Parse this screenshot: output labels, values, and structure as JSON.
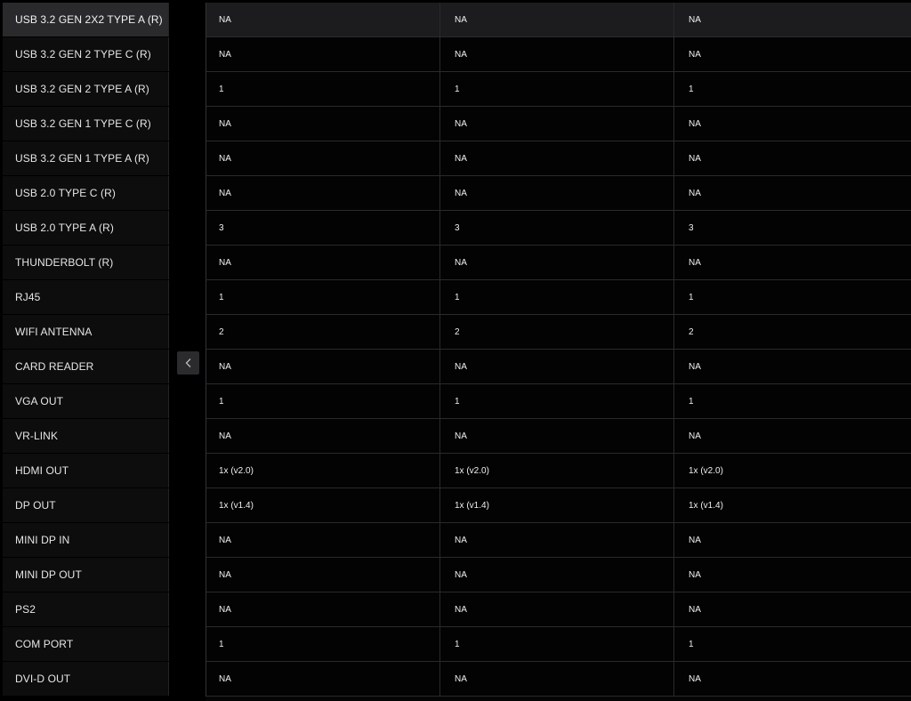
{
  "rows": [
    {
      "label": "USB 3.2 GEN 2X2 TYPE A (R)",
      "values": [
        "NA",
        "NA",
        "NA"
      ]
    },
    {
      "label": "USB 3.2 GEN 2 TYPE C (R)",
      "values": [
        "NA",
        "NA",
        "NA"
      ]
    },
    {
      "label": "USB 3.2 GEN 2 TYPE A (R)",
      "values": [
        "1",
        "1",
        "1"
      ]
    },
    {
      "label": "USB 3.2 GEN 1 TYPE C (R)",
      "values": [
        "NA",
        "NA",
        "NA"
      ]
    },
    {
      "label": "USB 3.2 GEN 1 TYPE A (R)",
      "values": [
        "NA",
        "NA",
        "NA"
      ]
    },
    {
      "label": "USB 2.0 TYPE C (R)",
      "values": [
        "NA",
        "NA",
        "NA"
      ]
    },
    {
      "label": "USB 2.0 TYPE A (R)",
      "values": [
        "3",
        "3",
        "3"
      ]
    },
    {
      "label": "THUNDERBOLT (R)",
      "values": [
        "NA",
        "NA",
        "NA"
      ]
    },
    {
      "label": "RJ45",
      "values": [
        "1",
        "1",
        "1"
      ]
    },
    {
      "label": "WIFI ANTENNA",
      "values": [
        "2",
        "2",
        "2"
      ]
    },
    {
      "label": "CARD READER",
      "values": [
        "NA",
        "NA",
        "NA"
      ]
    },
    {
      "label": "VGA OUT",
      "values": [
        "1",
        "1",
        "1"
      ]
    },
    {
      "label": "VR-LINK",
      "values": [
        "NA",
        "NA",
        "NA"
      ]
    },
    {
      "label": "HDMI OUT",
      "values": [
        "1x (v2.0)",
        "1x (v2.0)",
        "1x (v2.0)"
      ]
    },
    {
      "label": "DP OUT",
      "values": [
        "1x (v1.4)",
        "1x (v1.4)",
        "1x (v1.4)"
      ]
    },
    {
      "label": "MINI DP IN",
      "values": [
        "NA",
        "NA",
        "NA"
      ]
    },
    {
      "label": "MINI DP OUT",
      "values": [
        "NA",
        "NA",
        "NA"
      ]
    },
    {
      "label": "PS2",
      "values": [
        "NA",
        "NA",
        "NA"
      ]
    },
    {
      "label": "COM PORT",
      "values": [
        "1",
        "1",
        "1"
      ]
    },
    {
      "label": "DVI-D OUT",
      "values": [
        "NA",
        "NA",
        "NA"
      ]
    }
  ],
  "collapse_button": {
    "icon": "chevron-left-icon"
  },
  "colors": {
    "background": "#000000",
    "label_bg": "#0d0d0e",
    "label_active_bg": "#2a2a2d",
    "header_row_bg": "#1c1c1e",
    "divider": "#2a2a2c",
    "text": "#f0f0f0"
  }
}
